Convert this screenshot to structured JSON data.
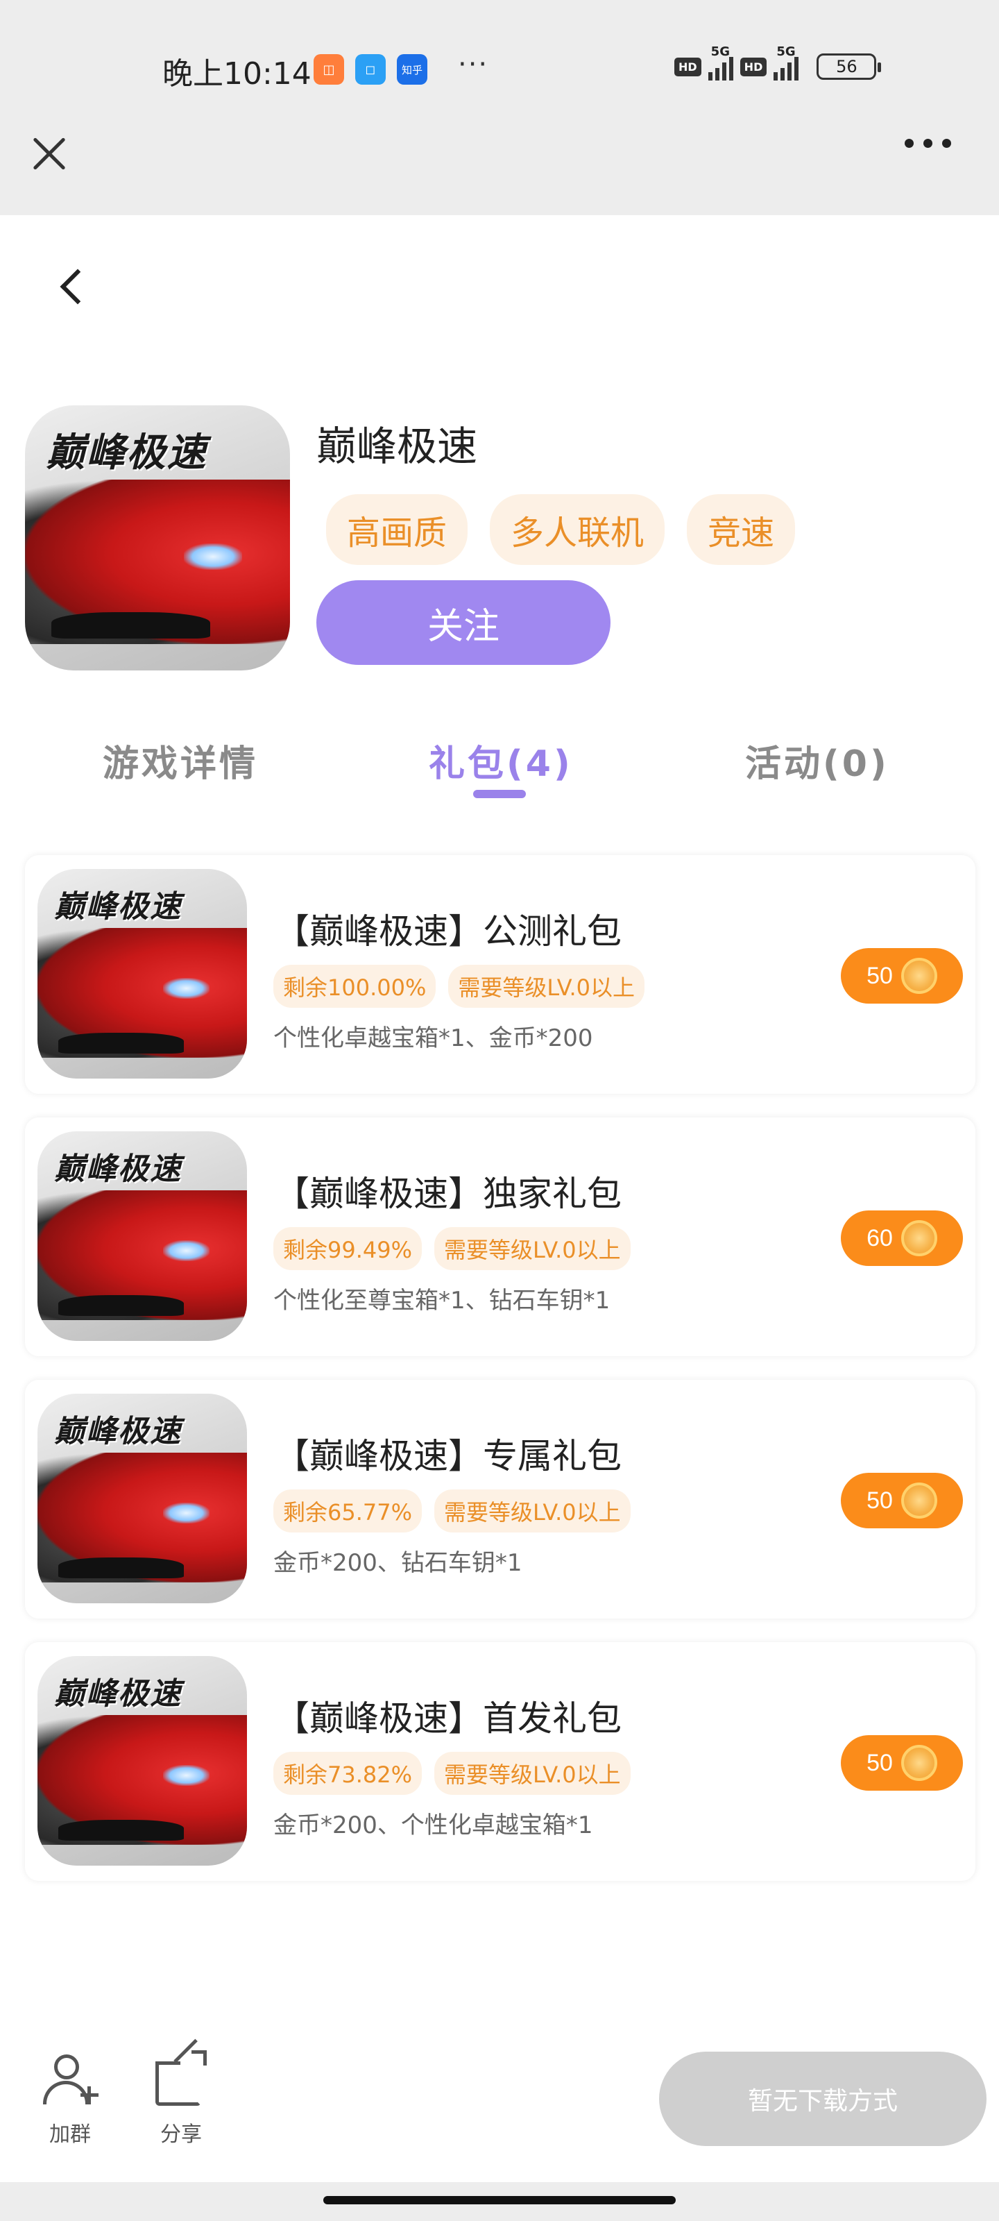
{
  "status_bar": {
    "time": "晚上10:14",
    "app_icons": [
      "淘宝",
      "",
      "知乎"
    ],
    "more": "···",
    "hd1": "HD",
    "hd2": "HD",
    "net1": "5G",
    "net2": "5G",
    "battery": "56"
  },
  "game": {
    "title": "巅峰极速",
    "icon_text": "巅峰极速",
    "tags": [
      "高画质",
      "多人联机",
      "竞速"
    ],
    "follow_label": "关注"
  },
  "tabs": [
    {
      "label": "游戏详情",
      "active": false
    },
    {
      "label": "礼包(4)",
      "active": true
    },
    {
      "label": "活动(0)",
      "active": false
    }
  ],
  "gifts": [
    {
      "name": "【巅峰极速】公测礼包",
      "remaining": "剩余100.00%",
      "level": "需要等级LV.0以上",
      "desc": "个性化卓越宝箱*1、金币*200",
      "price": "50"
    },
    {
      "name": "【巅峰极速】独家礼包",
      "remaining": "剩余99.49%",
      "level": "需要等级LV.0以上",
      "desc": "个性化至尊宝箱*1、钻石车钥*1",
      "price": "60"
    },
    {
      "name": "【巅峰极速】专属礼包",
      "remaining": "剩余65.77%",
      "level": "需要等级LV.0以上",
      "desc": "金币*200、钻石车钥*1",
      "price": "50"
    },
    {
      "name": "【巅峰极速】首发礼包",
      "remaining": "剩余73.82%",
      "level": "需要等级LV.0以上",
      "desc": "金币*200、个性化卓越宝箱*1",
      "price": "50"
    }
  ],
  "bottom": {
    "join_group": "加群",
    "share": "分享",
    "download": "暂无下载方式"
  },
  "colors": {
    "accent_purple": "#9a82ea",
    "follow_button": "#a088f0",
    "orange": "#fb8c1a",
    "tag_bg": "#fdf1e4",
    "tag_text": "#ea8f28",
    "disabled": "#cfcfcf"
  }
}
